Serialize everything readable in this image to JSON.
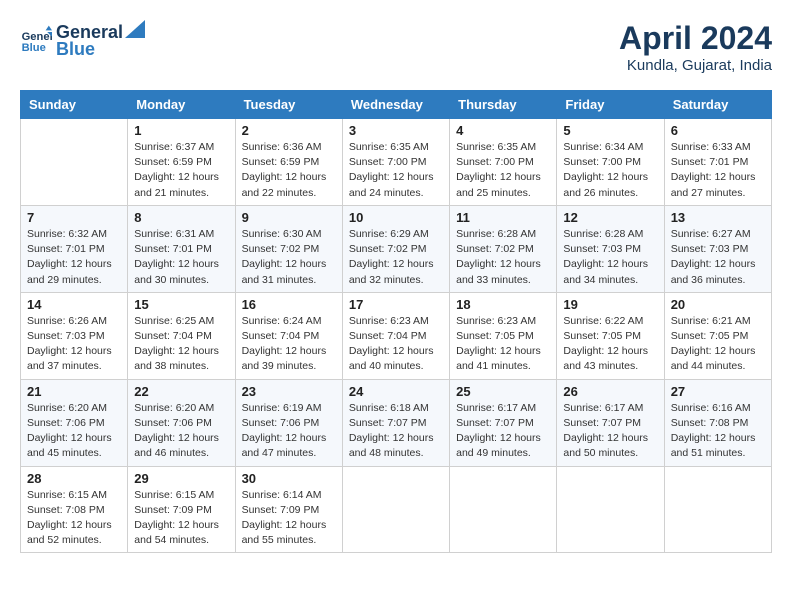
{
  "header": {
    "logo_line1": "General",
    "logo_line2": "Blue",
    "month_title": "April 2024",
    "location": "Kundla, Gujarat, India"
  },
  "weekdays": [
    "Sunday",
    "Monday",
    "Tuesday",
    "Wednesday",
    "Thursday",
    "Friday",
    "Saturday"
  ],
  "weeks": [
    [
      {
        "day": "",
        "content": ""
      },
      {
        "day": "1",
        "content": "Sunrise: 6:37 AM\nSunset: 6:59 PM\nDaylight: 12 hours\nand 21 minutes."
      },
      {
        "day": "2",
        "content": "Sunrise: 6:36 AM\nSunset: 6:59 PM\nDaylight: 12 hours\nand 22 minutes."
      },
      {
        "day": "3",
        "content": "Sunrise: 6:35 AM\nSunset: 7:00 PM\nDaylight: 12 hours\nand 24 minutes."
      },
      {
        "day": "4",
        "content": "Sunrise: 6:35 AM\nSunset: 7:00 PM\nDaylight: 12 hours\nand 25 minutes."
      },
      {
        "day": "5",
        "content": "Sunrise: 6:34 AM\nSunset: 7:00 PM\nDaylight: 12 hours\nand 26 minutes."
      },
      {
        "day": "6",
        "content": "Sunrise: 6:33 AM\nSunset: 7:01 PM\nDaylight: 12 hours\nand 27 minutes."
      }
    ],
    [
      {
        "day": "7",
        "content": "Sunrise: 6:32 AM\nSunset: 7:01 PM\nDaylight: 12 hours\nand 29 minutes."
      },
      {
        "day": "8",
        "content": "Sunrise: 6:31 AM\nSunset: 7:01 PM\nDaylight: 12 hours\nand 30 minutes."
      },
      {
        "day": "9",
        "content": "Sunrise: 6:30 AM\nSunset: 7:02 PM\nDaylight: 12 hours\nand 31 minutes."
      },
      {
        "day": "10",
        "content": "Sunrise: 6:29 AM\nSunset: 7:02 PM\nDaylight: 12 hours\nand 32 minutes."
      },
      {
        "day": "11",
        "content": "Sunrise: 6:28 AM\nSunset: 7:02 PM\nDaylight: 12 hours\nand 33 minutes."
      },
      {
        "day": "12",
        "content": "Sunrise: 6:28 AM\nSunset: 7:03 PM\nDaylight: 12 hours\nand 34 minutes."
      },
      {
        "day": "13",
        "content": "Sunrise: 6:27 AM\nSunset: 7:03 PM\nDaylight: 12 hours\nand 36 minutes."
      }
    ],
    [
      {
        "day": "14",
        "content": "Sunrise: 6:26 AM\nSunset: 7:03 PM\nDaylight: 12 hours\nand 37 minutes."
      },
      {
        "day": "15",
        "content": "Sunrise: 6:25 AM\nSunset: 7:04 PM\nDaylight: 12 hours\nand 38 minutes."
      },
      {
        "day": "16",
        "content": "Sunrise: 6:24 AM\nSunset: 7:04 PM\nDaylight: 12 hours\nand 39 minutes."
      },
      {
        "day": "17",
        "content": "Sunrise: 6:23 AM\nSunset: 7:04 PM\nDaylight: 12 hours\nand 40 minutes."
      },
      {
        "day": "18",
        "content": "Sunrise: 6:23 AM\nSunset: 7:05 PM\nDaylight: 12 hours\nand 41 minutes."
      },
      {
        "day": "19",
        "content": "Sunrise: 6:22 AM\nSunset: 7:05 PM\nDaylight: 12 hours\nand 43 minutes."
      },
      {
        "day": "20",
        "content": "Sunrise: 6:21 AM\nSunset: 7:05 PM\nDaylight: 12 hours\nand 44 minutes."
      }
    ],
    [
      {
        "day": "21",
        "content": "Sunrise: 6:20 AM\nSunset: 7:06 PM\nDaylight: 12 hours\nand 45 minutes."
      },
      {
        "day": "22",
        "content": "Sunrise: 6:20 AM\nSunset: 7:06 PM\nDaylight: 12 hours\nand 46 minutes."
      },
      {
        "day": "23",
        "content": "Sunrise: 6:19 AM\nSunset: 7:06 PM\nDaylight: 12 hours\nand 47 minutes."
      },
      {
        "day": "24",
        "content": "Sunrise: 6:18 AM\nSunset: 7:07 PM\nDaylight: 12 hours\nand 48 minutes."
      },
      {
        "day": "25",
        "content": "Sunrise: 6:17 AM\nSunset: 7:07 PM\nDaylight: 12 hours\nand 49 minutes."
      },
      {
        "day": "26",
        "content": "Sunrise: 6:17 AM\nSunset: 7:07 PM\nDaylight: 12 hours\nand 50 minutes."
      },
      {
        "day": "27",
        "content": "Sunrise: 6:16 AM\nSunset: 7:08 PM\nDaylight: 12 hours\nand 51 minutes."
      }
    ],
    [
      {
        "day": "28",
        "content": "Sunrise: 6:15 AM\nSunset: 7:08 PM\nDaylight: 12 hours\nand 52 minutes."
      },
      {
        "day": "29",
        "content": "Sunrise: 6:15 AM\nSunset: 7:09 PM\nDaylight: 12 hours\nand 54 minutes."
      },
      {
        "day": "30",
        "content": "Sunrise: 6:14 AM\nSunset: 7:09 PM\nDaylight: 12 hours\nand 55 minutes."
      },
      {
        "day": "",
        "content": ""
      },
      {
        "day": "",
        "content": ""
      },
      {
        "day": "",
        "content": ""
      },
      {
        "day": "",
        "content": ""
      }
    ]
  ]
}
